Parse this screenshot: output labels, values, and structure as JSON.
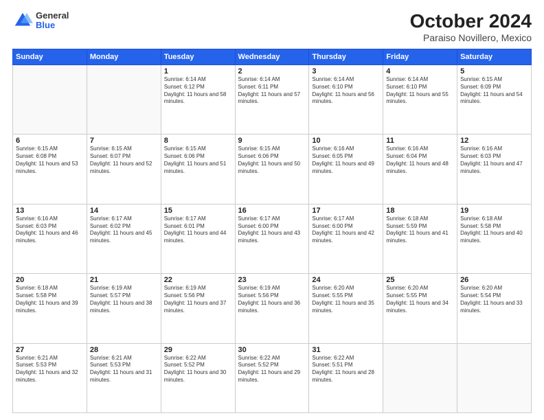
{
  "header": {
    "logo_general": "General",
    "logo_blue": "Blue",
    "title": "October 2024",
    "subtitle": "Paraiso Novillero, Mexico"
  },
  "calendar": {
    "days_of_week": [
      "Sunday",
      "Monday",
      "Tuesday",
      "Wednesday",
      "Thursday",
      "Friday",
      "Saturday"
    ],
    "weeks": [
      [
        {
          "day": "",
          "info": ""
        },
        {
          "day": "",
          "info": ""
        },
        {
          "day": "1",
          "info": "Sunrise: 6:14 AM\nSunset: 6:12 PM\nDaylight: 11 hours and 58 minutes."
        },
        {
          "day": "2",
          "info": "Sunrise: 6:14 AM\nSunset: 6:11 PM\nDaylight: 11 hours and 57 minutes."
        },
        {
          "day": "3",
          "info": "Sunrise: 6:14 AM\nSunset: 6:10 PM\nDaylight: 11 hours and 56 minutes."
        },
        {
          "day": "4",
          "info": "Sunrise: 6:14 AM\nSunset: 6:10 PM\nDaylight: 11 hours and 55 minutes."
        },
        {
          "day": "5",
          "info": "Sunrise: 6:15 AM\nSunset: 6:09 PM\nDaylight: 11 hours and 54 minutes."
        }
      ],
      [
        {
          "day": "6",
          "info": "Sunrise: 6:15 AM\nSunset: 6:08 PM\nDaylight: 11 hours and 53 minutes."
        },
        {
          "day": "7",
          "info": "Sunrise: 6:15 AM\nSunset: 6:07 PM\nDaylight: 11 hours and 52 minutes."
        },
        {
          "day": "8",
          "info": "Sunrise: 6:15 AM\nSunset: 6:06 PM\nDaylight: 11 hours and 51 minutes."
        },
        {
          "day": "9",
          "info": "Sunrise: 6:15 AM\nSunset: 6:06 PM\nDaylight: 11 hours and 50 minutes."
        },
        {
          "day": "10",
          "info": "Sunrise: 6:16 AM\nSunset: 6:05 PM\nDaylight: 11 hours and 49 minutes."
        },
        {
          "day": "11",
          "info": "Sunrise: 6:16 AM\nSunset: 6:04 PM\nDaylight: 11 hours and 48 minutes."
        },
        {
          "day": "12",
          "info": "Sunrise: 6:16 AM\nSunset: 6:03 PM\nDaylight: 11 hours and 47 minutes."
        }
      ],
      [
        {
          "day": "13",
          "info": "Sunrise: 6:16 AM\nSunset: 6:03 PM\nDaylight: 11 hours and 46 minutes."
        },
        {
          "day": "14",
          "info": "Sunrise: 6:17 AM\nSunset: 6:02 PM\nDaylight: 11 hours and 45 minutes."
        },
        {
          "day": "15",
          "info": "Sunrise: 6:17 AM\nSunset: 6:01 PM\nDaylight: 11 hours and 44 minutes."
        },
        {
          "day": "16",
          "info": "Sunrise: 6:17 AM\nSunset: 6:00 PM\nDaylight: 11 hours and 43 minutes."
        },
        {
          "day": "17",
          "info": "Sunrise: 6:17 AM\nSunset: 6:00 PM\nDaylight: 11 hours and 42 minutes."
        },
        {
          "day": "18",
          "info": "Sunrise: 6:18 AM\nSunset: 5:59 PM\nDaylight: 11 hours and 41 minutes."
        },
        {
          "day": "19",
          "info": "Sunrise: 6:18 AM\nSunset: 5:58 PM\nDaylight: 11 hours and 40 minutes."
        }
      ],
      [
        {
          "day": "20",
          "info": "Sunrise: 6:18 AM\nSunset: 5:58 PM\nDaylight: 11 hours and 39 minutes."
        },
        {
          "day": "21",
          "info": "Sunrise: 6:19 AM\nSunset: 5:57 PM\nDaylight: 11 hours and 38 minutes."
        },
        {
          "day": "22",
          "info": "Sunrise: 6:19 AM\nSunset: 5:56 PM\nDaylight: 11 hours and 37 minutes."
        },
        {
          "day": "23",
          "info": "Sunrise: 6:19 AM\nSunset: 5:56 PM\nDaylight: 11 hours and 36 minutes."
        },
        {
          "day": "24",
          "info": "Sunrise: 6:20 AM\nSunset: 5:55 PM\nDaylight: 11 hours and 35 minutes."
        },
        {
          "day": "25",
          "info": "Sunrise: 6:20 AM\nSunset: 5:55 PM\nDaylight: 11 hours and 34 minutes."
        },
        {
          "day": "26",
          "info": "Sunrise: 6:20 AM\nSunset: 5:54 PM\nDaylight: 11 hours and 33 minutes."
        }
      ],
      [
        {
          "day": "27",
          "info": "Sunrise: 6:21 AM\nSunset: 5:53 PM\nDaylight: 11 hours and 32 minutes."
        },
        {
          "day": "28",
          "info": "Sunrise: 6:21 AM\nSunset: 5:53 PM\nDaylight: 11 hours and 31 minutes."
        },
        {
          "day": "29",
          "info": "Sunrise: 6:22 AM\nSunset: 5:52 PM\nDaylight: 11 hours and 30 minutes."
        },
        {
          "day": "30",
          "info": "Sunrise: 6:22 AM\nSunset: 5:52 PM\nDaylight: 11 hours and 29 minutes."
        },
        {
          "day": "31",
          "info": "Sunrise: 6:22 AM\nSunset: 5:51 PM\nDaylight: 11 hours and 28 minutes."
        },
        {
          "day": "",
          "info": ""
        },
        {
          "day": "",
          "info": ""
        }
      ]
    ]
  }
}
